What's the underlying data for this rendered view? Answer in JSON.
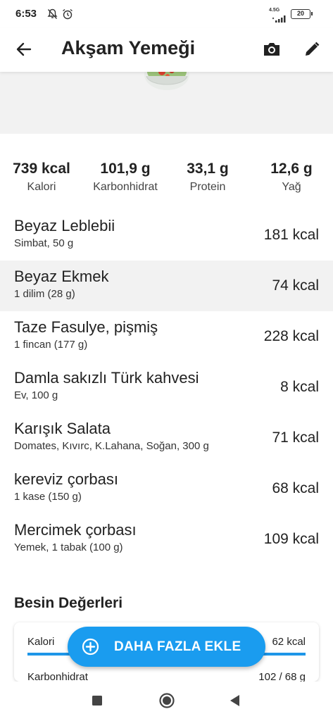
{
  "status_bar": {
    "time": "6:53",
    "network": "4.5G",
    "battery": "20"
  },
  "app_bar": {
    "title": "Akşam Yemeği",
    "back_icon": "arrow-back-icon",
    "camera_icon": "camera-icon",
    "edit_icon": "pencil-icon"
  },
  "summary": [
    {
      "value": "739 kcal",
      "label": "Kalori"
    },
    {
      "value": "101,9 g",
      "label": "Karbonhidrat"
    },
    {
      "value": "33,1 g",
      "label": "Protein"
    },
    {
      "value": "12,6 g",
      "label": "Yağ"
    }
  ],
  "foods": [
    {
      "name": "Beyaz Leblebii",
      "desc": "Simbat, 50 g",
      "kcal": "181 kcal"
    },
    {
      "name": "Beyaz Ekmek",
      "desc": "1 dilim (28 g)",
      "kcal": "74 kcal"
    },
    {
      "name": "Taze Fasulye, pişmiş",
      "desc": "1 fincan (177 g)",
      "kcal": "228 kcal"
    },
    {
      "name": "Damla sakızlı Türk kahvesi",
      "desc": "Ev, 100 g",
      "kcal": "8 kcal"
    },
    {
      "name": "Karışık Salata",
      "desc": "Domates, Kıvırc, K.Lahana, Soğan, 300 g",
      "kcal": "71 kcal"
    },
    {
      "name": "kereviz çorbası",
      "desc": "1 kase (150 g)",
      "kcal": "68 kcal"
    },
    {
      "name": "Mercimek çorbası",
      "desc": "Yemek, 1 tabak (100 g)",
      "kcal": "109 kcal"
    }
  ],
  "nutrition": {
    "title": "Besin Değerleri",
    "rows": [
      {
        "label": "Kalori",
        "value": "62 kcal",
        "progress": 1.0
      },
      {
        "label": "Karbonhidrat",
        "value": "102 / 68 g"
      }
    ]
  },
  "fab": {
    "label": "DAHA FAZLA EKLE",
    "icon": "plus-circle-icon"
  },
  "colors": {
    "accent": "#1a9cef",
    "highlight_row": "#f2f2f2"
  }
}
